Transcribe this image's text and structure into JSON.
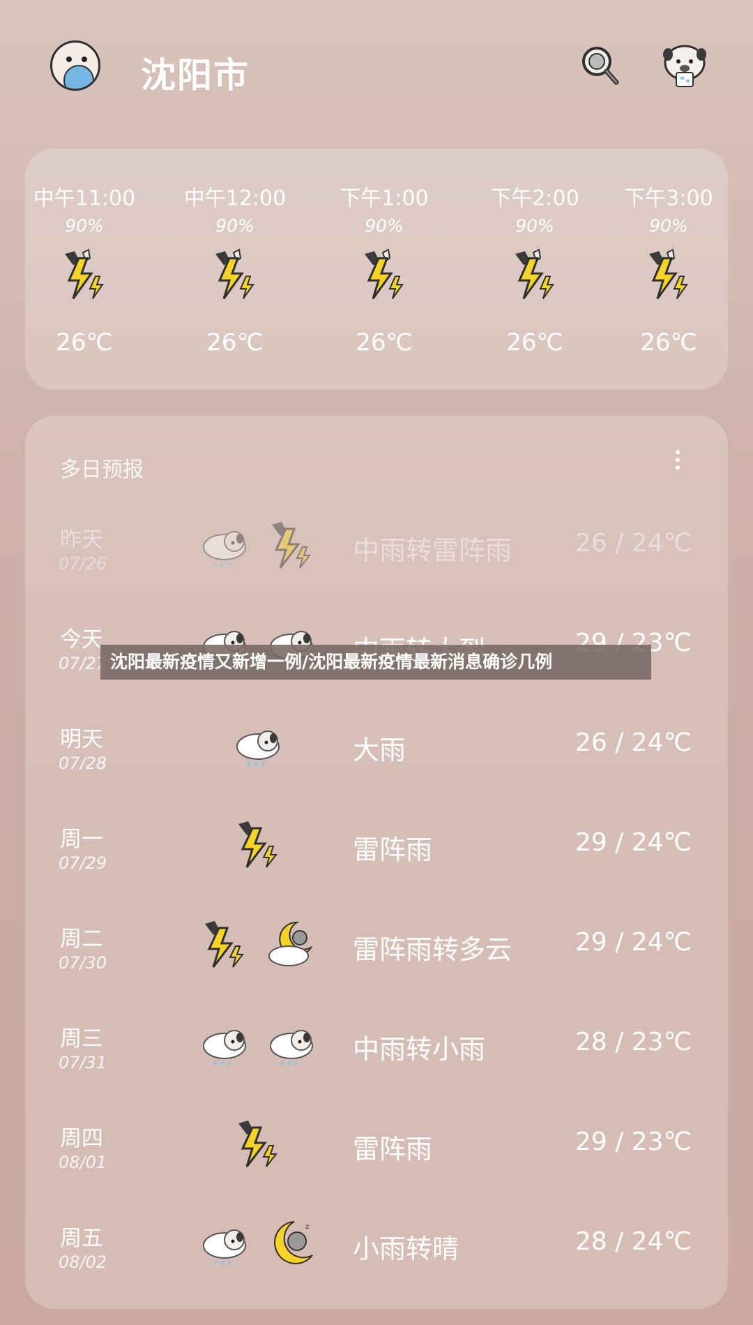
{
  "header": {
    "city": "沈阳市"
  },
  "hourly": [
    {
      "time": "中午11:00",
      "precip": "90%",
      "icon": "thunderstorm-icon",
      "temp": "26℃"
    },
    {
      "time": "中午12:00",
      "precip": "90%",
      "icon": "thunderstorm-icon",
      "temp": "26℃"
    },
    {
      "time": "下午1:00",
      "precip": "90%",
      "icon": "thunderstorm-icon",
      "temp": "26℃"
    },
    {
      "time": "下午2:00",
      "precip": "90%",
      "icon": "thunderstorm-icon",
      "temp": "26℃"
    },
    {
      "time": "下午3:00",
      "precip": "90%",
      "icon": "thunderstorm-icon",
      "temp": "26℃"
    }
  ],
  "daily": {
    "title": "多日预报",
    "days": [
      {
        "day": "昨天",
        "date": "07/26",
        "icons": [
          "rain-cloud-icon",
          "thunderstorm-icon"
        ],
        "desc": "中雨转雷阵雨",
        "range": "26 / 24℃"
      },
      {
        "day": "今天",
        "date": "07/27",
        "icons": [
          "rain-cloud-icon",
          "rain-cloud-icon"
        ],
        "desc": "中雨转大到…",
        "range": "29 / 23℃"
      },
      {
        "day": "明天",
        "date": "07/28",
        "icons": [
          "rain-cloud-icon"
        ],
        "desc": "大雨",
        "range": "26 / 24℃"
      },
      {
        "day": "周一",
        "date": "07/29",
        "icons": [
          "thunderstorm-icon"
        ],
        "desc": "雷阵雨",
        "range": "29 / 24℃"
      },
      {
        "day": "周二",
        "date": "07/30",
        "icons": [
          "thunderstorm-icon",
          "moon-cloud-icon"
        ],
        "desc": "雷阵雨转多云",
        "range": "29 / 24℃"
      },
      {
        "day": "周三",
        "date": "07/31",
        "icons": [
          "rain-cloud-icon",
          "rain-cloud-icon"
        ],
        "desc": "中雨转小雨",
        "range": "28 / 23℃"
      },
      {
        "day": "周四",
        "date": "08/01",
        "icons": [
          "thunderstorm-icon"
        ],
        "desc": "雷阵雨",
        "range": "29 / 23℃"
      },
      {
        "day": "周五",
        "date": "08/02",
        "icons": [
          "rain-cloud-icon",
          "moon-icon"
        ],
        "desc": "小雨转晴",
        "range": "28 / 24℃"
      }
    ]
  },
  "banner": {
    "text": "沈阳最新疫情又新增一例/沈阳最新疫情最新消息确诊几例"
  }
}
